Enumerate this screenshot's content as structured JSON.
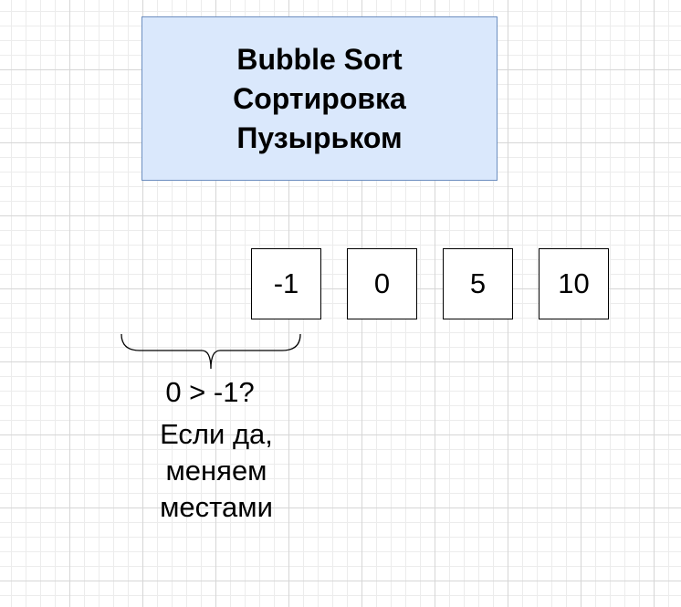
{
  "title": {
    "lines": [
      "Bubble Sort",
      "Сортировка",
      "Пузырьком"
    ]
  },
  "array": {
    "cells": [
      "-1",
      "0",
      "5",
      "10"
    ]
  },
  "comparison": {
    "question": "0 > -1?",
    "action_lines": [
      "Если да,",
      "меняем",
      "местами"
    ]
  },
  "colors": {
    "title_fill": "#dae8fc",
    "title_stroke": "#6c8ebf",
    "cell_stroke": "#000000",
    "brace_stroke": "#000000"
  }
}
